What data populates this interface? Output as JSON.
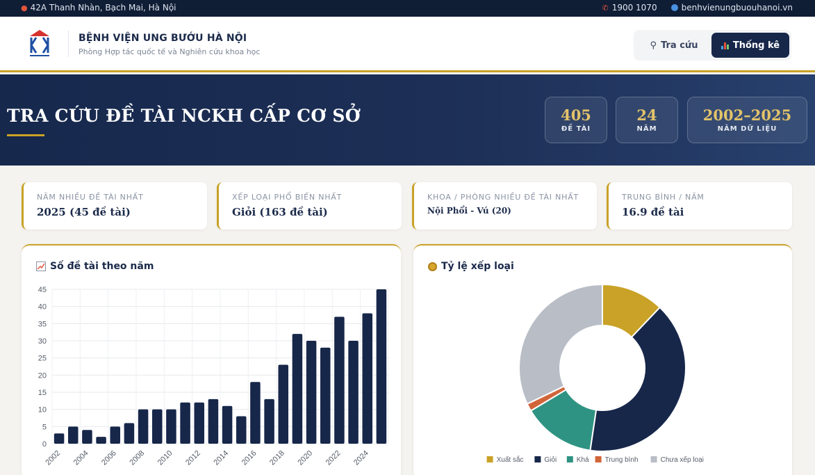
{
  "topbar": {
    "address": "42A Thanh Nhàn, Bạch Mai, Hà Nội",
    "phone": "1900 1070",
    "website": "benhvienungbuouhanoi.vn"
  },
  "header": {
    "title": "BỆNH VIỆN UNG BƯỚU HÀ NỘI",
    "subtitle": "Phòng Hợp tác quốc tế và Nghiên cứu khoa học",
    "nav": {
      "search_label": "Tra cứu",
      "stats_label": "Thống kê",
      "active": "stats"
    }
  },
  "hero": {
    "title": "TRA CỨU ĐỀ TÀI NCKH CẤP CƠ SỞ",
    "stats": [
      {
        "value": "405",
        "label": "ĐỀ TÀI"
      },
      {
        "value": "24",
        "label": "NĂM"
      },
      {
        "value": "2002–2025",
        "label": "NĂM DỮ LIỆU"
      }
    ]
  },
  "summary": [
    {
      "label": "NĂM NHIỀU ĐỀ TÀI NHẤT",
      "value": "2025 (45 đề tài)"
    },
    {
      "label": "XẾP LOẠI PHỔ BIẾN NHẤT",
      "value": "Giỏi (163 đề tài)"
    },
    {
      "label": "KHOA / PHÒNG NHIỀU ĐỀ TÀI NHẤT",
      "value": "Nội Phổi - Vú (20)"
    },
    {
      "label": "TRUNG BÌNH / NĂM",
      "value": "16.9 đề tài"
    }
  ],
  "panels": {
    "bar_title": "Số đề tài theo năm",
    "donut_title": "Tỷ lệ xếp loại"
  },
  "colors": {
    "navy": "#17274a",
    "gold": "#c9a227",
    "teal": "#2f9383",
    "orange": "#d0653a",
    "gray": "#b9bdc6"
  },
  "chart_data": [
    {
      "type": "bar",
      "title": "Số đề tài theo năm",
      "categories": [
        "2002",
        "2003",
        "2004",
        "2005",
        "2006",
        "2007",
        "2008",
        "2009",
        "2010",
        "2011",
        "2012",
        "2013",
        "2014",
        "2015",
        "2016",
        "2017",
        "2018",
        "2019",
        "2020",
        "2021",
        "2022",
        "2023",
        "2024",
        "2025"
      ],
      "tick_labels": [
        "2002",
        "2004",
        "2006",
        "2008",
        "2010",
        "2012",
        "2014",
        "2016",
        "2018",
        "2020",
        "2022",
        "2024"
      ],
      "values": [
        3,
        5,
        4,
        2,
        5,
        6,
        10,
        10,
        10,
        12,
        12,
        13,
        11,
        8,
        18,
        13,
        23,
        32,
        30,
        28,
        37,
        30,
        38,
        45
      ],
      "ylim": [
        0,
        45
      ],
      "yticks": [
        0,
        5,
        10,
        15,
        20,
        25,
        30,
        35,
        40,
        45
      ],
      "grid": true,
      "color": "#17274a"
    },
    {
      "type": "pie",
      "title": "Tỷ lệ xếp loại",
      "donut": true,
      "labels": [
        "Xuất sắc",
        "Giỏi",
        "Khá",
        "Trung bình",
        "Chưa xếp loại"
      ],
      "values": [
        49,
        163,
        57,
        6,
        130
      ],
      "colors": [
        "#c9a227",
        "#17274a",
        "#2f9383",
        "#d0653a",
        "#b9bdc6"
      ],
      "legend": "bottom"
    }
  ]
}
